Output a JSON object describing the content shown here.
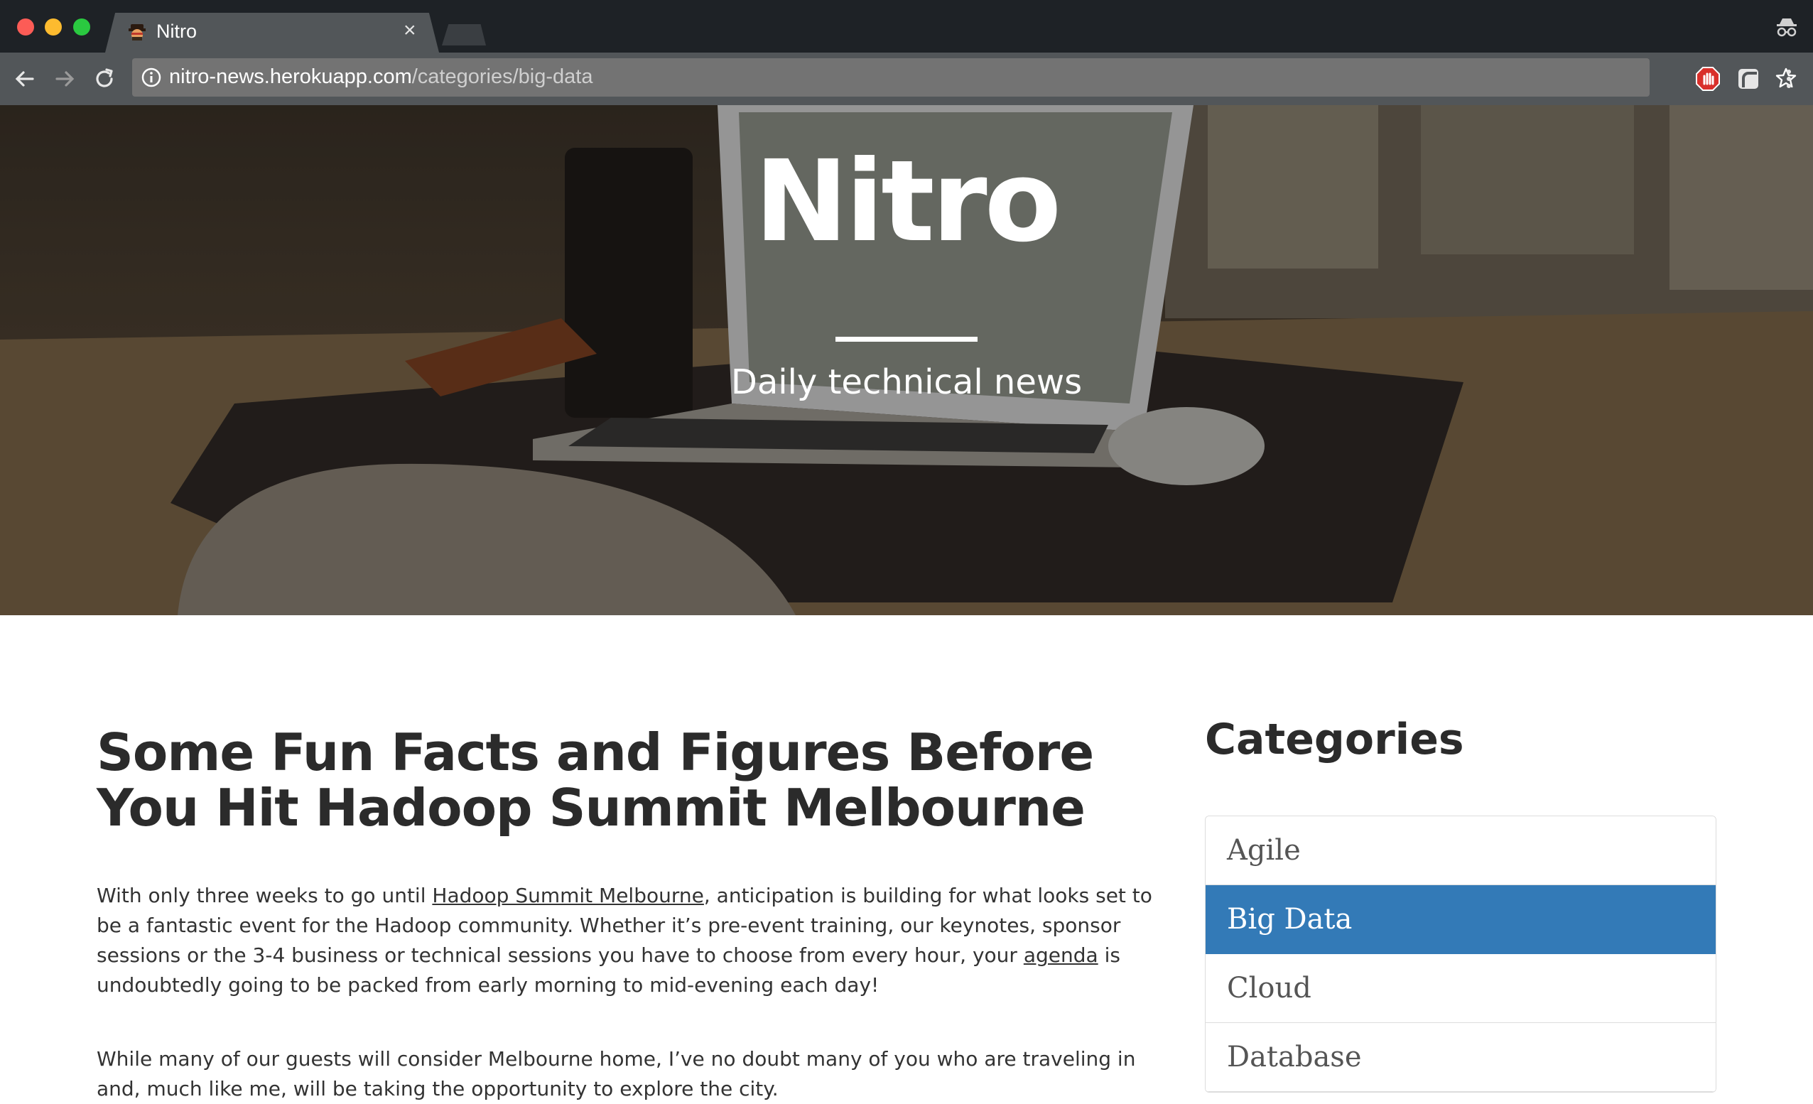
{
  "browser": {
    "tab_title": "Nitro",
    "tab_close": "×",
    "url_host": "nitro-news.herokuapp.com",
    "url_path": "/categories/big-data"
  },
  "hero": {
    "title": "Nitro",
    "subtitle": "Daily technical news"
  },
  "article": {
    "title": "Some Fun Facts and Figures Before You Hit Hadoop Summit Melbourne",
    "p1": {
      "text_a": "With only three weeks to go until ",
      "link_summit": "Hadoop Summit Melbourne",
      "text_b": ", anticipation is building for what looks set to be a fantastic event for the Hadoop community.   Whether it’s pre-event training, our keynotes, sponsor sessions or the 3-4 business or technical sessions you have to choose from every hour, your ",
      "link_agenda": "agenda",
      "text_c": " is undoubtedly going to be packed from early morning to mid-evening each day!"
    },
    "p2": "While many of our guests will consider Melbourne home, I’ve no doubt many of you who are traveling in and, much like me, will be taking the opportunity to explore the city."
  },
  "sidebar": {
    "heading": "Categories",
    "categories": [
      {
        "label": "Agile"
      },
      {
        "label": "Big Data"
      },
      {
        "label": "Cloud"
      },
      {
        "label": "Database"
      }
    ],
    "active_index": 1
  },
  "colors": {
    "accent": "#337ab7",
    "chrome_dark": "#1e2226",
    "chrome_toolbar": "#525659"
  }
}
